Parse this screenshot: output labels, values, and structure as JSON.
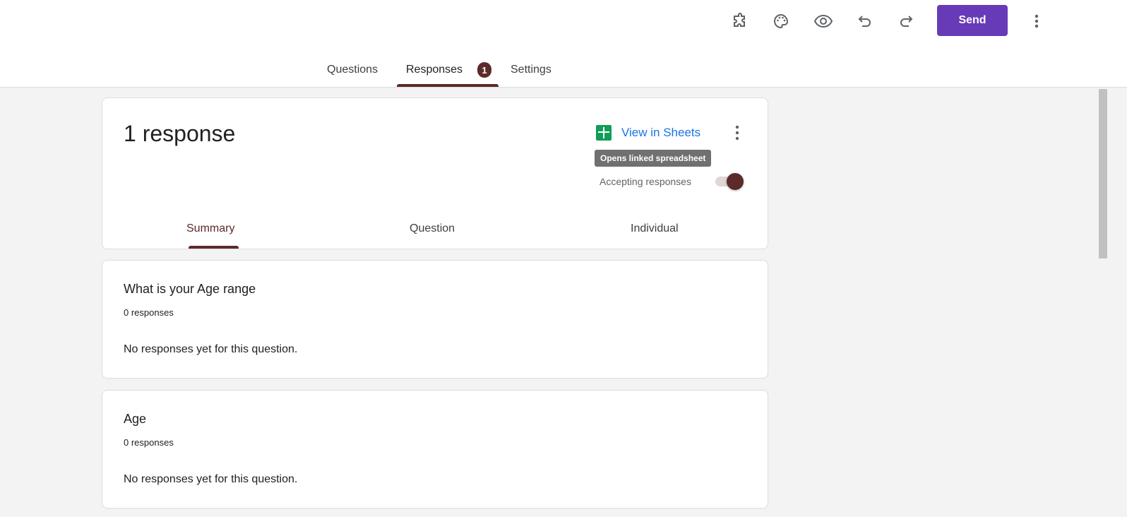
{
  "header": {
    "send_label": "Send",
    "icons": [
      "puzzle-icon",
      "palette-icon",
      "eye-icon",
      "undo-icon",
      "redo-icon",
      "more-vert-icon"
    ]
  },
  "tabs": {
    "questions": "Questions",
    "responses": "Responses",
    "responses_badge": "1",
    "settings": "Settings"
  },
  "summary_card": {
    "title": "1 response",
    "view_in_sheets": "View in Sheets",
    "tooltip": "Opens linked spreadsheet",
    "accepting": "Accepting responses",
    "accepting_on": true,
    "subtabs": [
      "Summary",
      "Question",
      "Individual"
    ]
  },
  "questions": [
    {
      "title": "What is your Age range",
      "count": "0 responses",
      "empty": "No responses yet for this question."
    },
    {
      "title": "Age",
      "count": "0 responses",
      "empty": "No responses yet for this question."
    }
  ],
  "colors": {
    "accent": "#5b2a29",
    "send": "#673ab7",
    "link": "#1a73e8",
    "sheets": "#0f9d58"
  }
}
